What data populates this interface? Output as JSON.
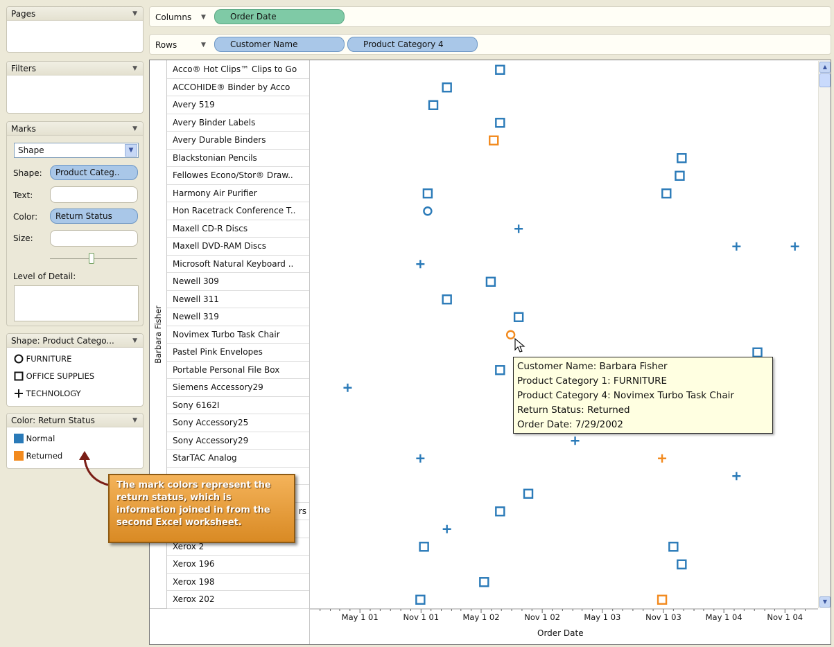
{
  "pages": {
    "title": "Pages"
  },
  "filters": {
    "title": "Filters"
  },
  "marks": {
    "title": "Marks",
    "mark_type": "Shape",
    "shape_label": "Shape:",
    "shape_value": "Product Categ..",
    "text_label": "Text:",
    "color_label": "Color:",
    "color_value": "Return Status",
    "size_label": "Size:",
    "lod_label": "Level of Detail:"
  },
  "shape_legend": {
    "title": "Shape: Product Catego...",
    "items": [
      {
        "shape": "circle",
        "label": "FURNITURE"
      },
      {
        "shape": "square",
        "label": "OFFICE SUPPLIES"
      },
      {
        "shape": "plus",
        "label": "TECHNOLOGY"
      }
    ]
  },
  "color_legend": {
    "title": "Color: Return Status",
    "items": [
      {
        "label": "Normal",
        "color": "#2a7ab8"
      },
      {
        "label": "Returned",
        "color": "#f28a1e"
      }
    ]
  },
  "shelves": {
    "columns_label": "Columns",
    "rows_label": "Rows",
    "columns_pill": "Order Date",
    "rows_pill_1": "Customer Name",
    "rows_pill_2": "Product Category 4"
  },
  "customer": "Barbara Fisher",
  "products": [
    "Acco® Hot Clips™ Clips to Go",
    "ACCOHIDE® Binder by Acco",
    "Avery 519",
    "Avery Binder Labels",
    "Avery Durable Binders",
    "Blackstonian Pencils",
    "Fellowes Econo/Stor® Draw..",
    "Harmony Air Purifier",
    "Hon Racetrack Conference T..",
    "Maxell CD-R Discs",
    "Maxell DVD-RAM Discs",
    "Microsoft Natural Keyboard ..",
    "Newell 309",
    "Newell 311",
    "Newell 319",
    "Novimex Turbo Task Chair",
    "Pastel Pink Envelopes",
    "Portable Personal File Box",
    "Siemens Accessory29",
    "Sony 6162I",
    "Sony Accessory25",
    "Sony Accessory29",
    "StarTAC Analog",
    "",
    "",
    "rs",
    "",
    "Xerox 2",
    "Xerox 196",
    "Xerox 198",
    "Xerox 202"
  ],
  "chart_data": {
    "type": "scatter",
    "x_axis_title": "Order Date",
    "x_ticks": [
      "May 1 01",
      "Nov 1 01",
      "May 1 02",
      "Nov 1 02",
      "May 1 03",
      "Nov 1 03",
      "May 1 04",
      "Nov 1 04"
    ],
    "x_range": [
      "2000-12-18",
      "2005-01-25"
    ],
    "points": [
      {
        "row": 0,
        "date": "2002-06-27",
        "shape": "square",
        "status": "Normal"
      },
      {
        "row": 1,
        "date": "2002-01-18",
        "shape": "square",
        "status": "Normal"
      },
      {
        "row": 2,
        "date": "2001-12-08",
        "shape": "square",
        "status": "Normal"
      },
      {
        "row": 3,
        "date": "2002-06-27",
        "shape": "square",
        "status": "Normal"
      },
      {
        "row": 4,
        "date": "2002-06-08",
        "shape": "square",
        "status": "Returned"
      },
      {
        "row": 5,
        "date": "2003-12-26",
        "shape": "square",
        "status": "Normal"
      },
      {
        "row": 6,
        "date": "2003-12-20",
        "shape": "square",
        "status": "Normal"
      },
      {
        "row": 7,
        "date": "2001-11-21",
        "shape": "square",
        "status": "Normal"
      },
      {
        "row": 7,
        "date": "2003-11-10",
        "shape": "square",
        "status": "Normal"
      },
      {
        "row": 8,
        "date": "2001-11-21",
        "shape": "circle",
        "status": "Normal"
      },
      {
        "row": 9,
        "date": "2002-08-22",
        "shape": "plus",
        "status": "Normal"
      },
      {
        "row": 10,
        "date": "2004-06-08",
        "shape": "plus",
        "status": "Normal"
      },
      {
        "row": 10,
        "date": "2004-12-01",
        "shape": "plus",
        "status": "Normal"
      },
      {
        "row": 11,
        "date": "2001-10-30",
        "shape": "plus",
        "status": "Normal"
      },
      {
        "row": 12,
        "date": "2002-05-30",
        "shape": "square",
        "status": "Normal"
      },
      {
        "row": 13,
        "date": "2002-01-18",
        "shape": "square",
        "status": "Normal"
      },
      {
        "row": 14,
        "date": "2002-08-22",
        "shape": "square",
        "status": "Normal"
      },
      {
        "row": 15,
        "date": "2002-07-29",
        "shape": "circle",
        "status": "Returned"
      },
      {
        "row": 16,
        "date": "2004-08-10",
        "shape": "square",
        "status": "Normal"
      },
      {
        "row": 17,
        "date": "2002-06-27",
        "shape": "square",
        "status": "Normal"
      },
      {
        "row": 18,
        "date": "2001-03-25",
        "shape": "plus",
        "status": "Normal"
      },
      {
        "row": 21,
        "date": "2003-02-08",
        "shape": "plus",
        "status": "Normal"
      },
      {
        "row": 22,
        "date": "2001-10-30",
        "shape": "plus",
        "status": "Normal"
      },
      {
        "row": 22,
        "date": "2003-10-28",
        "shape": "plus",
        "status": "Returned"
      },
      {
        "row": 23,
        "date": "2004-06-08",
        "shape": "plus",
        "status": "Normal"
      },
      {
        "row": 24,
        "date": "2002-09-20",
        "shape": "square",
        "status": "Normal"
      },
      {
        "row": 25,
        "date": "2002-06-27",
        "shape": "square",
        "status": "Normal"
      },
      {
        "row": 26,
        "date": "2002-01-18",
        "shape": "plus",
        "status": "Normal"
      },
      {
        "row": 27,
        "date": "2001-11-10",
        "shape": "square",
        "status": "Normal"
      },
      {
        "row": 27,
        "date": "2003-12-01",
        "shape": "square",
        "status": "Normal"
      },
      {
        "row": 28,
        "date": "2003-12-26",
        "shape": "square",
        "status": "Normal"
      },
      {
        "row": 29,
        "date": "2002-05-10",
        "shape": "square",
        "status": "Normal"
      },
      {
        "row": 30,
        "date": "2001-10-30",
        "shape": "square",
        "status": "Normal"
      },
      {
        "row": 30,
        "date": "2003-10-28",
        "shape": "square",
        "status": "Returned"
      }
    ]
  },
  "tooltip": {
    "lines": [
      "Customer Name: Barbara Fisher",
      "Product Category 1: FURNITURE",
      "Product Category 4: Novimex Turbo Task Chair",
      "Return Status: Returned",
      "Order Date: 7/29/2002"
    ]
  },
  "callout": {
    "text": "The mark colors represent the return status, which is information joined in from the second Excel worksheet."
  }
}
